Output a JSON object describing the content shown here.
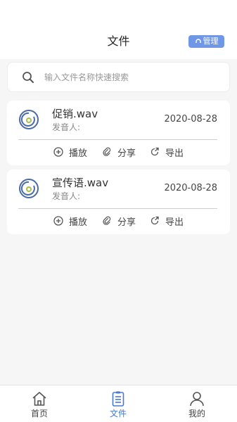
{
  "header": {
    "title": "文件",
    "manage_label": "管理"
  },
  "search": {
    "placeholder": "输入文件名称快速搜索"
  },
  "files": [
    {
      "name": "促销.wav",
      "speaker_label": "发音人:",
      "date": "2020-08-28"
    },
    {
      "name": "宣传语.wav",
      "speaker_label": "发音人:",
      "date": "2020-08-28"
    }
  ],
  "actions": {
    "play": "播放",
    "share": "分享",
    "export": "导出"
  },
  "tabs": [
    {
      "label": "首页",
      "icon": "home-icon",
      "active": false
    },
    {
      "label": "文件",
      "icon": "file-list-icon",
      "active": true
    },
    {
      "label": "我的",
      "icon": "user-icon",
      "active": false
    }
  ],
  "colors": {
    "accent": "#4a78d6",
    "manage_bg": "#6f97e6",
    "disc_outer": "#4a6aa8",
    "disc_center": "#a4c24a"
  }
}
